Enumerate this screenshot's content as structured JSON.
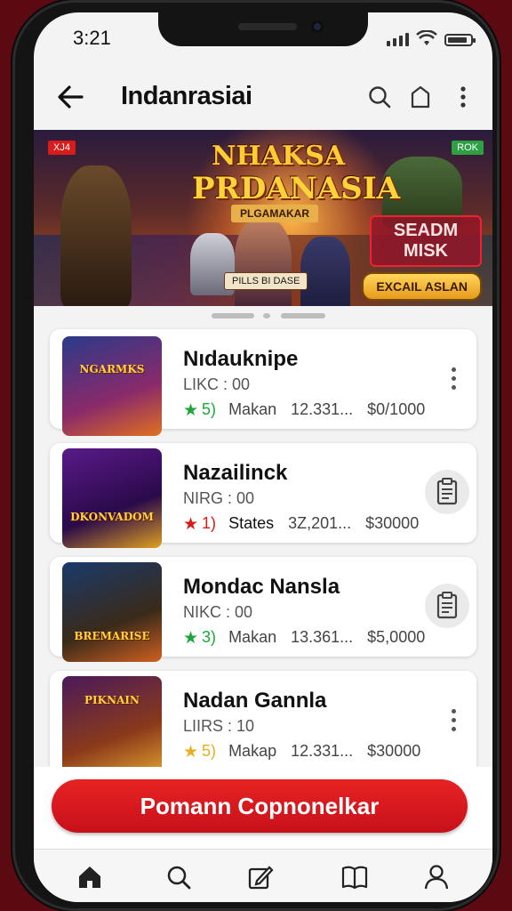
{
  "status": {
    "time": "3:21"
  },
  "appbar": {
    "title": "Indanrasiai"
  },
  "banner": {
    "headline_line1": "NHAKSA",
    "headline_line2": "PRDANASIA",
    "headline_tag": "PLGAMAKAR",
    "badge_left": "XJ4",
    "badge_right": "ROK",
    "side_title": "SEADM MISK",
    "cta": "EXCAIL ASLAN",
    "sub_tag": "PILLS BI DASE"
  },
  "list": [
    {
      "name": "Nıdauknipe",
      "sub": "LIKC : 00",
      "rating": "5)",
      "star_color": "#1aa83a",
      "label": "Makan",
      "count": "12.331...",
      "price": "$0/1000",
      "thumb_text": "NGARMKS",
      "thumb_bg": "#2a3a8a",
      "action": "more"
    },
    {
      "name": "Nazailinck",
      "sub": "NIRG : 00",
      "rating": "1)",
      "star_color": "#d81b1b",
      "label": "States",
      "count": "3Z,201...",
      "price": "$30000",
      "thumb_text": "DKONVADOM",
      "thumb_bg": "#5a1a8a",
      "action": "clipboard"
    },
    {
      "name": "Mondac Nansla",
      "sub": "NIKC : 00",
      "rating": "3)",
      "star_color": "#1aa83a",
      "label": "Makan",
      "count": "13.361...",
      "price": "$5,0000",
      "thumb_text": "BREMARISE",
      "thumb_bg": "#1a3a6a",
      "action": "clipboard"
    },
    {
      "name": "Nadan Gannla",
      "sub": "LIIRS : 10",
      "rating": "5)",
      "star_color": "#e8b020",
      "label": "Makap",
      "count": "12.331...",
      "price": "$30000",
      "thumb_text": "PIKNAIN",
      "thumb_bg": "#4a1a5a",
      "action": "more"
    }
  ],
  "primary_button": {
    "label": "Pomann Copnonelkar"
  },
  "nav": {
    "items": [
      "home-icon",
      "search-icon",
      "edit-icon",
      "book-icon",
      "profile-icon"
    ]
  }
}
